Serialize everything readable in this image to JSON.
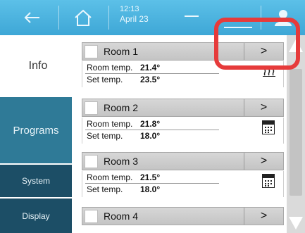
{
  "header": {
    "time": "12:13",
    "date": "April 23",
    "back_icon": "back-arrow-icon",
    "home_icon": "home-icon",
    "user_icon": "user-icon"
  },
  "sidebar": {
    "info_label": "Info",
    "programs_label": "Programs",
    "system_label": "System",
    "display_label": "Display"
  },
  "rooms": [
    {
      "name": "Room 1",
      "room_temp_label": "Room temp.",
      "room_temp": "21.4°",
      "set_temp_label": "Set temp.",
      "set_temp": "23.5°",
      "icon": "heating-icon"
    },
    {
      "name": "Room 2",
      "room_temp_label": "Room temp.",
      "room_temp": "21.8°",
      "set_temp_label": "Set temp.",
      "set_temp": "18.0°",
      "icon": "calendar-icon"
    },
    {
      "name": "Room 3",
      "room_temp_label": "Room temp.",
      "room_temp": "21.5°",
      "set_temp_label": "Set temp.",
      "set_temp": "18.0°",
      "icon": "calendar-icon"
    },
    {
      "name": "Room 4"
    }
  ],
  "arrow_glyph": ">",
  "heat_glyph": "≋",
  "colors": {
    "topbar": "#3ea7d6",
    "programs": "#2f7a97",
    "nav_dark": "#1c4e66",
    "highlight": "#e63b3b"
  }
}
